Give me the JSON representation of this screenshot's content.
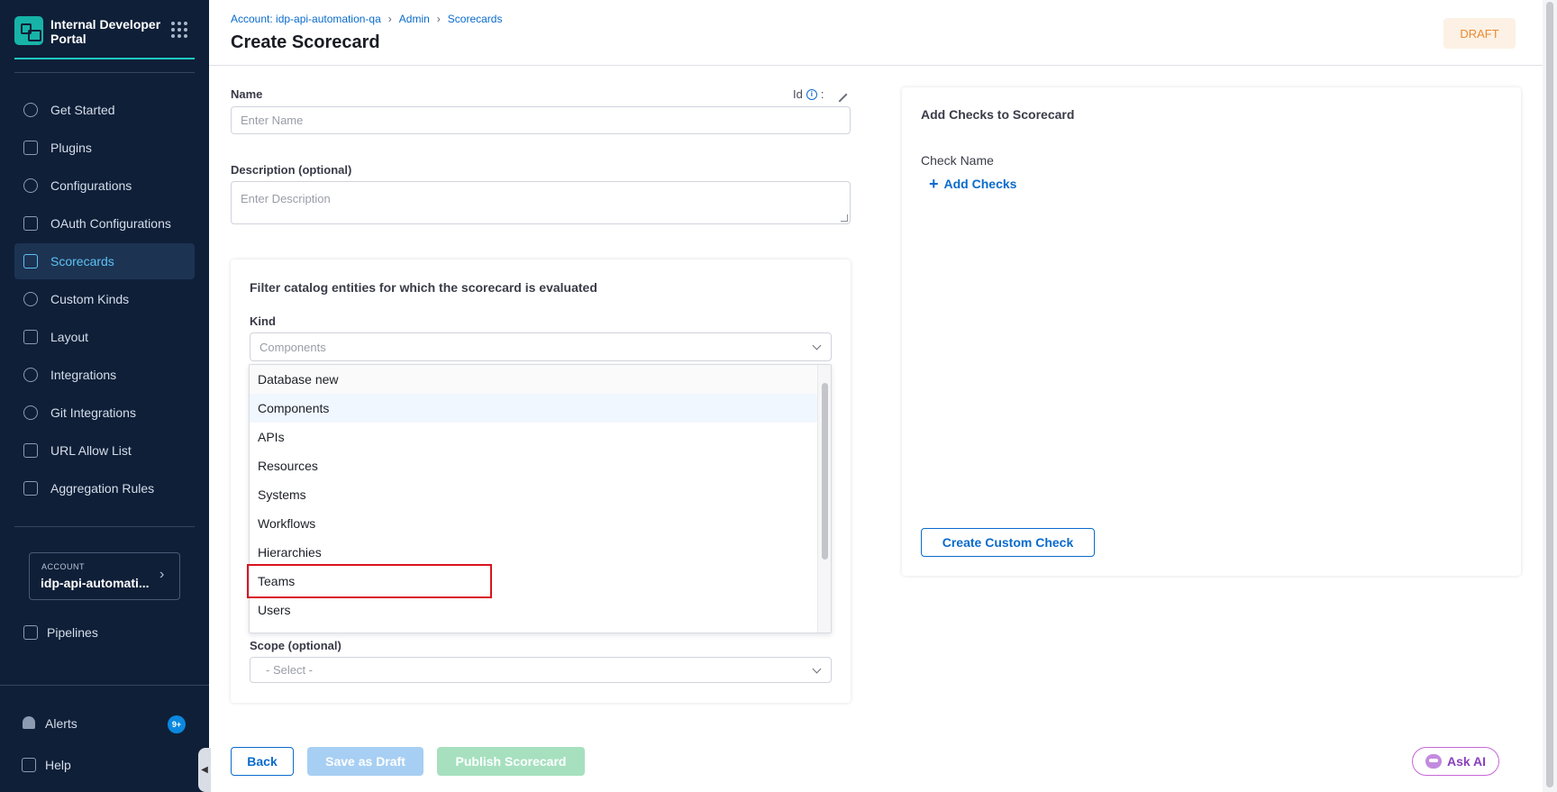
{
  "brand": {
    "title": "Internal Developer Portal"
  },
  "sidebar": {
    "items": [
      {
        "label": "Get Started",
        "icon": "play-circle-icon"
      },
      {
        "label": "Plugins",
        "icon": "plugin-icon"
      },
      {
        "label": "Configurations",
        "icon": "gear-icon"
      },
      {
        "label": "OAuth Configurations",
        "icon": "lock-icon"
      },
      {
        "label": "Scorecards",
        "icon": "scorecard-icon",
        "active": true
      },
      {
        "label": "Custom Kinds",
        "icon": "settings-icon"
      },
      {
        "label": "Layout",
        "icon": "layout-icon"
      },
      {
        "label": "Integrations",
        "icon": "integration-icon"
      },
      {
        "label": "Git Integrations",
        "icon": "git-icon"
      },
      {
        "label": "URL Allow List",
        "icon": "link-icon"
      },
      {
        "label": "Aggregation Rules",
        "icon": "chart-icon"
      }
    ],
    "account_tag": "ACCOUNT",
    "account_name": "idp-api-automati...",
    "pipelines": "Pipelines",
    "alerts": "Alerts",
    "alerts_badge": "9+",
    "help": "Help"
  },
  "header": {
    "breadcrumb": [
      "Account: idp-api-automation-qa",
      "Admin",
      "Scorecards"
    ],
    "title": "Create Scorecard",
    "status": "DRAFT"
  },
  "form": {
    "name_label": "Name",
    "name_placeholder": "Enter Name",
    "id_label": "Id",
    "id_separator": ":",
    "description_label": "Description (optional)",
    "description_placeholder": "Enter Description",
    "filter_title": "Filter catalog entities for which the scorecard is evaluated",
    "kind_label": "Kind",
    "kind_value": "Components",
    "kind_options": [
      "Database new",
      "Components",
      "APIs",
      "Resources",
      "Systems",
      "Workflows",
      "Hierarchies",
      "Teams",
      "Users"
    ],
    "kind_selected_index": 1,
    "scope_label": "Scope (optional)",
    "scope_value": "- Select -"
  },
  "checks": {
    "title": "Add Checks to Scorecard",
    "check_name_label": "Check Name",
    "add_checks": "Add Checks",
    "create_custom_check": "Create Custom Check"
  },
  "footer": {
    "back": "Back",
    "save_draft": "Save as Draft",
    "publish": "Publish Scorecard",
    "ask_ai": "Ask AI"
  },
  "colors": {
    "sidebar_bg": "#0f1f38",
    "accent": "#0a6bcc",
    "draft": "#ea8a33",
    "highlight": "#d9141e"
  }
}
